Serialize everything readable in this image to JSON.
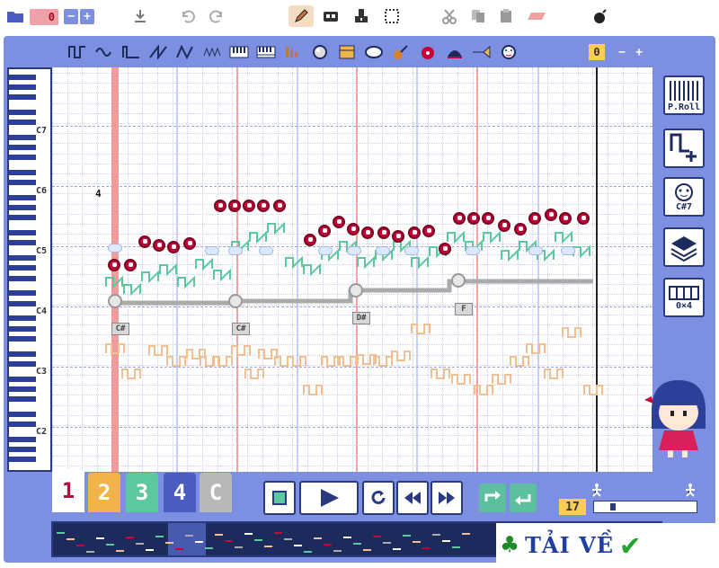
{
  "toolbar": {
    "counter_value": "0",
    "minus": "−",
    "plus": "+"
  },
  "instrument_bar": {
    "counter_value": "0",
    "minus": "−",
    "plus": "+"
  },
  "piano": {
    "octave_labels": [
      "C7",
      "C6",
      "C5",
      "C4",
      "C3",
      "C2"
    ]
  },
  "roll": {
    "beat_marker": "4",
    "chord_tags": [
      "C#",
      "C#",
      "D#",
      "F"
    ]
  },
  "side_panel": {
    "piano_roll_label": "P.Roll",
    "chord_label": "C#7",
    "pattern_label": "0×4"
  },
  "tracks": {
    "tabs": [
      {
        "label": "1",
        "color": "#ffffff",
        "text_color": "#c8003a"
      },
      {
        "label": "2",
        "color": "#f2b34a",
        "text_color": "#ffffff"
      },
      {
        "label": "3",
        "color": "#5cc8a0",
        "text_color": "#ffffff"
      },
      {
        "label": "4",
        "color": "#4a5cc0",
        "text_color": "#ffffff"
      },
      {
        "label": "C",
        "color": "#b8b8b8",
        "text_color": "#ffffff"
      }
    ]
  },
  "transport": {
    "bpm": "17"
  },
  "banner": {
    "text": "TẢI VỀ"
  },
  "colors": {
    "frame": "#7d8fe0",
    "note_main": "#c8003a",
    "note_green": "#5cc8a0",
    "note_orange": "#f2c090",
    "note_gray": "#aaaaaa"
  }
}
